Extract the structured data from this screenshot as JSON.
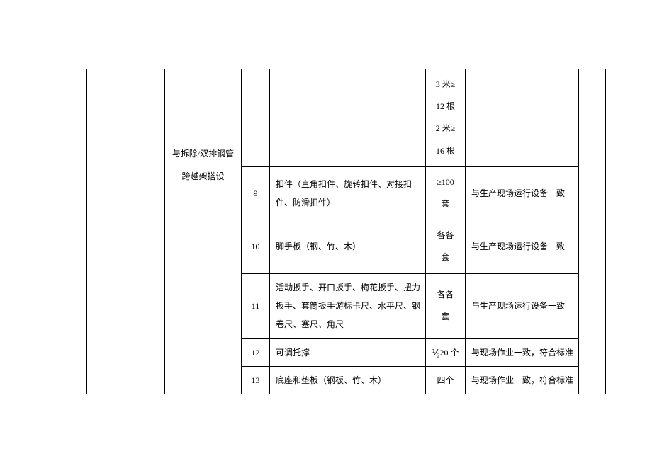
{
  "header_fragment": {
    "col_c_line1": "与拆除/双排钢管",
    "col_c_line2": "跨越架搭设",
    "col_f_lines": [
      "3 米≥",
      "12 根",
      "2 米≥",
      "16 根"
    ]
  },
  "rows": [
    {
      "num": "9",
      "desc": "扣件（直角扣件、旋转扣件、对接扣件、防滑扣件）",
      "qty_line1": "≥100",
      "qty_line2": "套",
      "note": "与生产现场运行设备一致"
    },
    {
      "num": "10",
      "desc": "脚手板（钢、竹、木）",
      "qty_line1": "各各",
      "qty_line2": "套",
      "note": "与生产现场运行设备一致"
    },
    {
      "num": "11",
      "desc": "活动扳手、开口扳手、梅花扳手、扭力扳手、套筒扳手游标卡尺、水平尺、钢卷尺、塞尺、角尺",
      "qty_line1": "各各",
      "qty_line2": "套",
      "note": "与生产现场运行设备一致"
    },
    {
      "num": "12",
      "desc": "可调托撑",
      "qty": "⅟₂20 个",
      "note": "与现场作业一致，符合标准"
    },
    {
      "num": "13",
      "desc": "底座和垫板（钢板、竹、木）",
      "qty": "四个",
      "note": "与现场作业一致，符合标准"
    }
  ]
}
